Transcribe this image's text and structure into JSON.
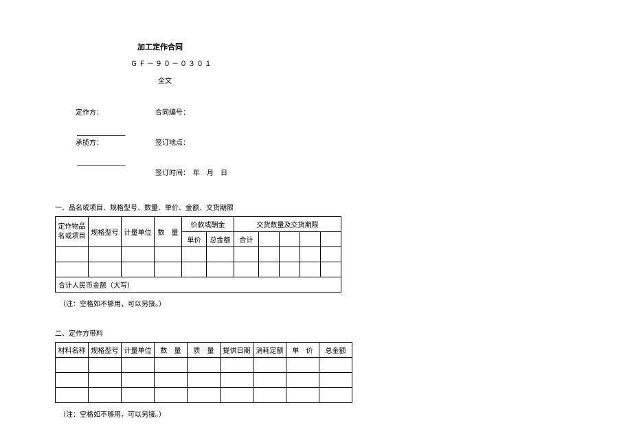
{
  "header": {
    "title": "加工定作合同",
    "code": "ＧＦ－９０－０３０１",
    "fulltext": "全文"
  },
  "parties": {
    "orderer_label": "定作方：",
    "contract_no_label": "合同编号：",
    "contractor_label": "承揽方：",
    "place_label": "签订地点：",
    "time_label": "签订时间：",
    "time_value": "年　月　日"
  },
  "section1": {
    "title": "一、品名或项目、规格型号、数量、单价、金额、交货期限",
    "t1": {
      "col1": "定作物品名或项目",
      "col2": "规格型号",
      "col3": "计量单位",
      "col4": "数　量",
      "group1": "价款或酬金",
      "col5": "单价",
      "col6": "总金额",
      "group2": "交货数量及交货期限",
      "col7": "合计",
      "sum_row": "合计人民币金额（大写）"
    },
    "note": "（注：空格如不够用，可以另接。）"
  },
  "section2": {
    "title": "二、定作方带料",
    "t2": {
      "col1": "材料名称",
      "col2": "规格型号",
      "col3": "计量单位",
      "col4": "数　量",
      "col5": "质　量",
      "col6": "提供日期",
      "col7": "消耗定额",
      "col8": "单　价",
      "col9": "总金额"
    },
    "note": "（注：空格如不够用，可以另接。）"
  }
}
